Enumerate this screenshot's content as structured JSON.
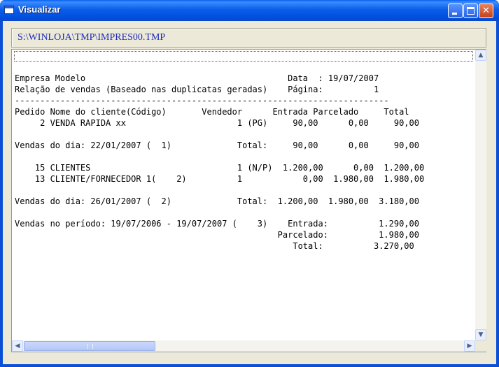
{
  "window": {
    "title": "Visualizar",
    "minimize_glyph": "",
    "maximize_glyph": "",
    "close_glyph": "✕"
  },
  "path": "S:\\WINLOJA\\TMP\\IMPRES00.TMP",
  "scroll": {
    "up_glyph": "▲",
    "down_glyph": "▼",
    "left_glyph": "◀",
    "right_glyph": "▶"
  },
  "report_lines": [
    "Empresa Modelo                                        Data  : 19/07/2007",
    "Relação de vendas (Baseado nas duplicatas geradas)    Página:          1",
    "--------------------------------------------------------------------------",
    "Pedido Nome do cliente(Código)       Vendedor      Entrada Parcelado     Total",
    "     2 VENDA RAPIDA xx                      1 (PG)     90,00      0,00     90,00",
    "",
    "Vendas do dia: 22/01/2007 (  1)             Total:     90,00      0,00     90,00",
    "",
    "    15 CLIENTES                             1 (N/P)  1.200,00      0,00  1.200,00",
    "    13 CLIENTE/FORNECEDOR 1(    2)          1            0,00  1.980,00  1.980,00",
    "",
    "Vendas do dia: 26/01/2007 (  2)             Total:  1.200,00  1.980,00  3.180,00",
    "",
    "Vendas no período: 19/07/2006 - 19/07/2007 (    3)    Entrada:          1.290,00",
    "                                                    Parcelado:          1.980,00",
    "                                                       Total:          3.270,00"
  ]
}
